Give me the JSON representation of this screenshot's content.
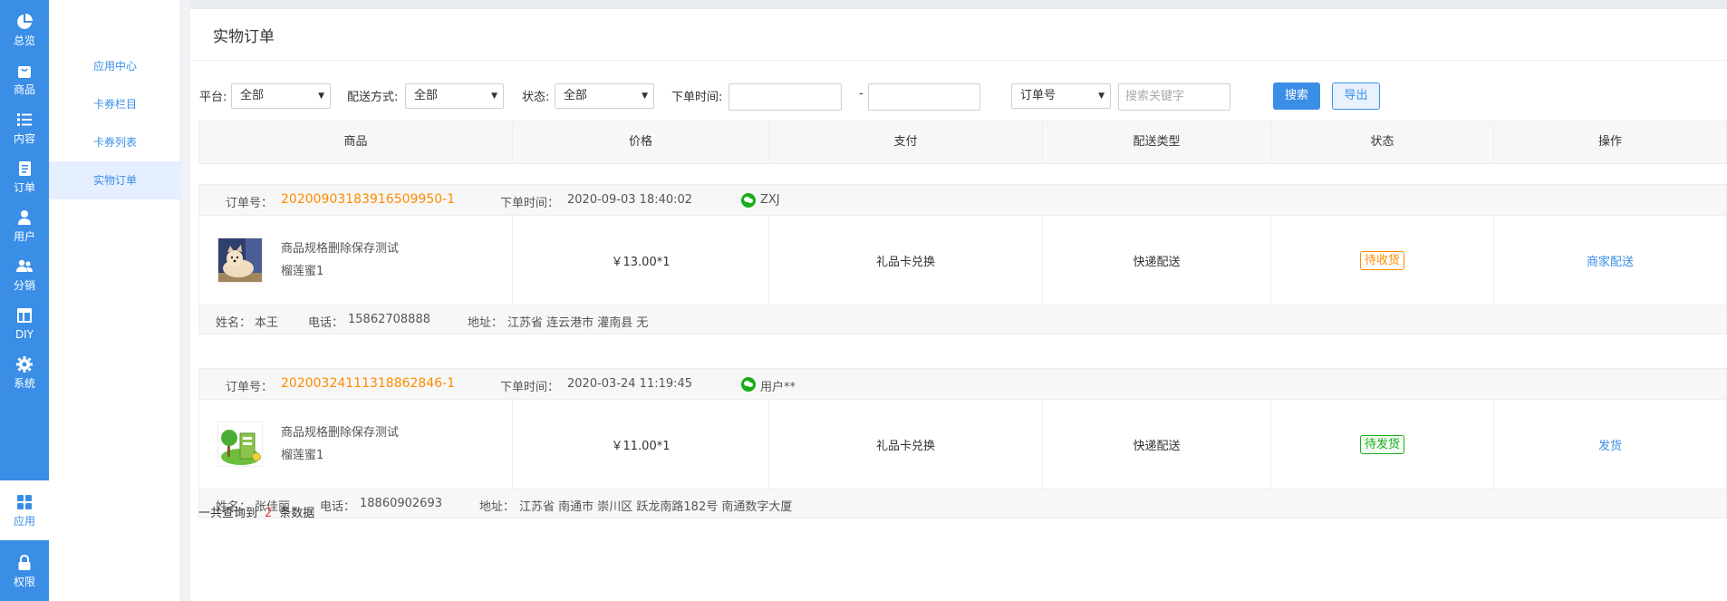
{
  "rail": {
    "items": [
      {
        "label": "总览",
        "icon": "pie-chart-icon"
      },
      {
        "label": "商品",
        "icon": "shopping-bag-icon"
      },
      {
        "label": "内容",
        "icon": "list-icon"
      },
      {
        "label": "订单",
        "icon": "order-document-icon"
      },
      {
        "label": "用户",
        "icon": "user-icon"
      },
      {
        "label": "分销",
        "icon": "users-icon"
      },
      {
        "label": "DIY",
        "icon": "layout-icon"
      },
      {
        "label": "系统",
        "icon": "gear-icon"
      },
      {
        "label": "应用",
        "icon": "apps-grid-icon"
      },
      {
        "label": "权限",
        "icon": "lock-icon"
      }
    ],
    "active": "应用",
    "accent": "#3a8ee6"
  },
  "submenu": {
    "items": [
      {
        "label": "应用中心"
      },
      {
        "label": "卡券栏目"
      },
      {
        "label": "卡券列表"
      },
      {
        "label": "实物订单"
      }
    ],
    "active": "实物订单"
  },
  "page": {
    "title": "实物订单"
  },
  "filters": {
    "platform_label": "平台:",
    "platform_value": "全部",
    "delivery_label": "配送方式:",
    "delivery_value": "全部",
    "status_label": "状态:",
    "status_value": "全部",
    "time_label": "下单时间:",
    "time_start": "",
    "time_sep": "-",
    "time_end": "",
    "keyword_type": "订单号",
    "keyword_placeholder": "搜索关键字",
    "search_label": "搜索",
    "export_label": "导出"
  },
  "table": {
    "columns": [
      "商品",
      "价格",
      "支付",
      "配送类型",
      "状态",
      "操作"
    ]
  },
  "orders": [
    {
      "order_no_label": "订单号：",
      "order_no": "20200903183916509950-1",
      "time_label": "下单时间：",
      "time": "2020-09-03 18:40:02",
      "user": "ZXJ",
      "goods_name": "商品规格删除保存测试",
      "goods_spec": "榴莲蜜1",
      "price": "￥13.00*1",
      "payment": "礼品卡兑换",
      "delivery": "快递配送",
      "status": "待收货",
      "status_color": "#ff8a00",
      "action": "商家配送",
      "name_label": "姓名：",
      "name": "本王",
      "phone_label": "电话：",
      "phone": "15862708888",
      "address_label": "地址：",
      "address": "江苏省 连云港市 灌南县 无"
    },
    {
      "order_no_label": "订单号：",
      "order_no": "20200324111318862846-1",
      "time_label": "下单时间：",
      "time": "2020-03-24 11:19:45",
      "user": "用户**",
      "goods_name": "商品规格删除保存测试",
      "goods_spec": "榴莲蜜1",
      "price": "￥11.00*1",
      "payment": "礼品卡兑换",
      "delivery": "快递配送",
      "status": "待发货",
      "status_color": "#1aad19",
      "action": "发货",
      "name_label": "姓名：",
      "name": "张佳丽",
      "phone_label": "电话：",
      "phone": "18860902693",
      "address_label": "地址：",
      "address": "江苏省 南通市 崇川区 跃龙南路182号 南通数字大厦"
    }
  ],
  "summary": {
    "prefix": "一共查询到",
    "count": "2",
    "suffix": "条数据"
  }
}
